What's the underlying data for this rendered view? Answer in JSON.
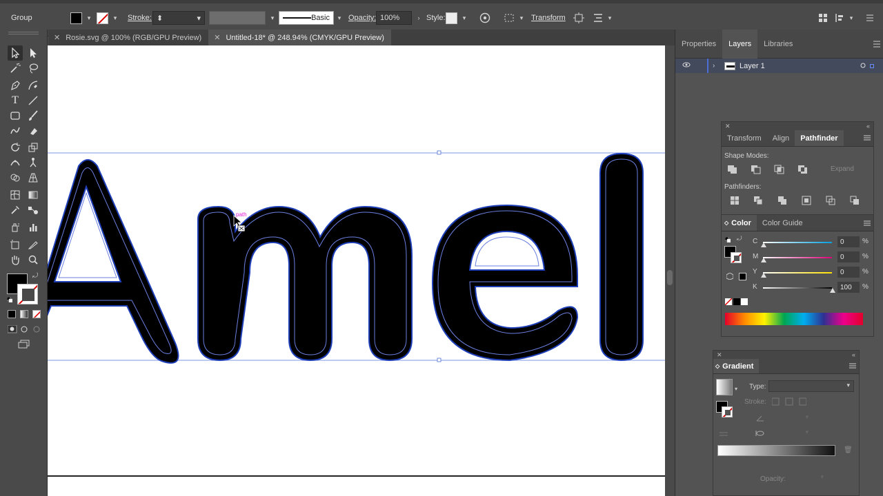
{
  "control_bar": {
    "selection_type": "Group",
    "stroke_label": "Stroke:",
    "brush_label": "Basic",
    "opacity_label": "Opacity:",
    "opacity_value": "100%",
    "style_label": "Style:",
    "transform_label": "Transform"
  },
  "tabs": [
    {
      "label": "Rosie.svg @ 100% (RGB/GPU Preview)",
      "active": false
    },
    {
      "label": "Untitled-18* @ 248.94% (CMYK/GPU Preview)",
      "active": true
    }
  ],
  "canvas": {
    "text": "Amel",
    "hover_label": "path"
  },
  "layers_panel": {
    "tabs": [
      "Properties",
      "Layers",
      "Libraries"
    ],
    "active_tab": "Layers",
    "layers": [
      {
        "name": "Layer 1"
      }
    ]
  },
  "pathfinder_panel": {
    "tabs": [
      "Transform",
      "Align",
      "Pathfinder"
    ],
    "active_tab": "Pathfinder",
    "shape_modes_label": "Shape Modes:",
    "expand_label": "Expand",
    "pathfinders_label": "Pathfinders:"
  },
  "color_panel": {
    "tabs": [
      "Color",
      "Color Guide"
    ],
    "active_tab": "Color",
    "channels": [
      {
        "name": "C",
        "value": "0",
        "unit": "%"
      },
      {
        "name": "M",
        "value": "0",
        "unit": "%"
      },
      {
        "name": "Y",
        "value": "0",
        "unit": "%"
      },
      {
        "name": "K",
        "value": "100",
        "unit": "%"
      }
    ]
  },
  "gradient_panel": {
    "title": "Gradient",
    "type_label": "Type:",
    "stroke_label": "Stroke:",
    "opacity_label": "Opacity:"
  },
  "colors": {
    "fill": "#000000",
    "accent": "#4c6fd6",
    "selection": "#1f3fb8"
  }
}
